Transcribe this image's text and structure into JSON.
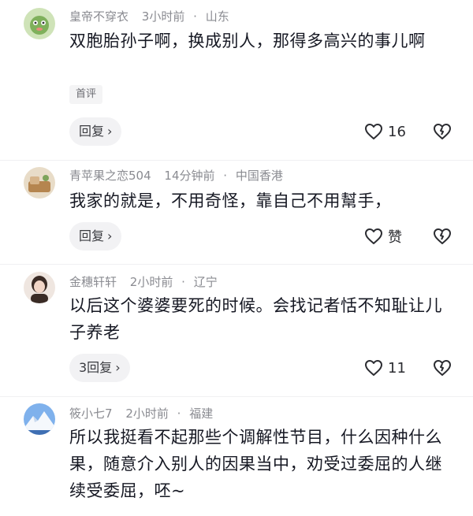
{
  "comments": [
    {
      "user": "皇帝不穿衣",
      "time": "3小时前",
      "location": "山东",
      "text": "双胞胎孙子啊，换成别人，那得多高兴的事儿啊",
      "tag": "首评",
      "reply": "回复",
      "likes": "16",
      "avatar_color": "#9bc27a"
    },
    {
      "user": "青苹果之恋504",
      "time": "14分钟前",
      "location": "中国香港",
      "text": "我家的就是，不用奇怪，靠自己不用幫手，",
      "reply": "回复",
      "likes": "赞",
      "avatar_color": "#c9a57a"
    },
    {
      "user": "金穗轩轩",
      "time": "2小时前",
      "location": "辽宁",
      "text": "以后这个婆婆要死的时候。会找记者恬不知耻让儿子养老",
      "reply": "3回复",
      "likes": "11",
      "avatar_color": "#d8c3b6"
    },
    {
      "user": "筱小七7",
      "time": "2小时前",
      "location": "福建",
      "text": "所以我挺看不起那些个调解性节目，什么因种什么果，随意介入别人的因果当中，劝受过委屈的人继续受委屈，呸~",
      "avatar_color": "#5b8fd6"
    }
  ],
  "icons": {
    "like": "heart-outline-icon",
    "dislike": "broken-heart-icon",
    "chevron": "chevron-right-icon"
  },
  "colors": {
    "meta_text": "#8a8b91",
    "body_text": "#161823",
    "pill_bg": "#f2f2f4"
  }
}
